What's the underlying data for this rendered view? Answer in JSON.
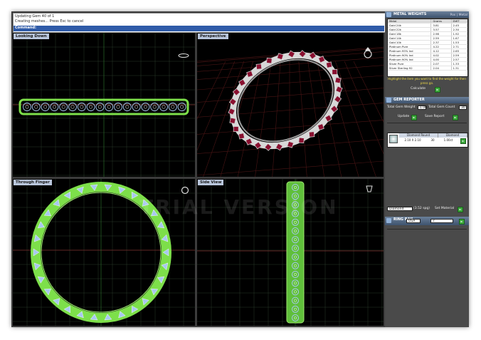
{
  "command": {
    "line1": "Updating Gem 40 of 1",
    "line2": "Creating meshes... Press Esc to cancel",
    "prompt": "Command:"
  },
  "viewports": {
    "top": "Looking Down",
    "perspective": "Perspective",
    "front": "Through Finger",
    "right": "Side View"
  },
  "watermark": "TRIAL VERSION",
  "metal_weights": {
    "title": "METAL WEIGHTS",
    "tabs": "Pos | Metal",
    "columns": [
      "Metal",
      "Grams",
      "DWT"
    ],
    "rows": [
      [
        "Gold 24k",
        "3.81",
        "2.45"
      ],
      [
        "Gold 22k",
        "3.57",
        "2.30"
      ],
      [
        "Gold 18k",
        "2.98",
        "1.92"
      ],
      [
        "Gold 14k",
        "2.59",
        "1.67"
      ],
      [
        "Gold 10k",
        "2.37",
        "1.53"
      ],
      [
        "Platinum Pure",
        "4.22",
        "2.71"
      ],
      [
        "Platinum 95% Ind",
        "4.12",
        "2.65"
      ],
      [
        "Platinum 90% Ind",
        "4.02",
        "2.59"
      ],
      [
        "Platinum 90% Ind",
        "4.00",
        "2.57"
      ],
      [
        "Silver Pure",
        "2.07",
        "1.33"
      ],
      [
        "Silver Sterling 92",
        "2.04",
        "1.31"
      ]
    ],
    "hint": "Highlight the item you want to find the weight for then press go.",
    "calculate": "Calculate"
  },
  "gem_reporter": {
    "title": "GEM REPORTER",
    "total_weight_label": "Total Gem Weight",
    "total_weight_value": "1.00",
    "total_count_label": "Total Gem Count",
    "total_count_value": "30",
    "update": "Update",
    "save_report": "Save Report",
    "gem_type": "Diamond Round",
    "gem_material": "Diamond",
    "gem_size": "2.10 X 2.10",
    "gem_count": "30",
    "gem_ct": "1.00ct"
  },
  "material": {
    "select": "Diamond",
    "density": "(3.52 spg)",
    "set_label": "Set Material"
  },
  "ring_rail": {
    "title": "RING RAIL",
    "unit": "USA",
    "size": "7"
  },
  "colors": {
    "grid": "#2a3a2a",
    "ring_green": "#7ddf4a",
    "gem_blue": "#a8c8f0",
    "ruby": "#8a1030",
    "panel_bg": "#4a4a4a"
  }
}
